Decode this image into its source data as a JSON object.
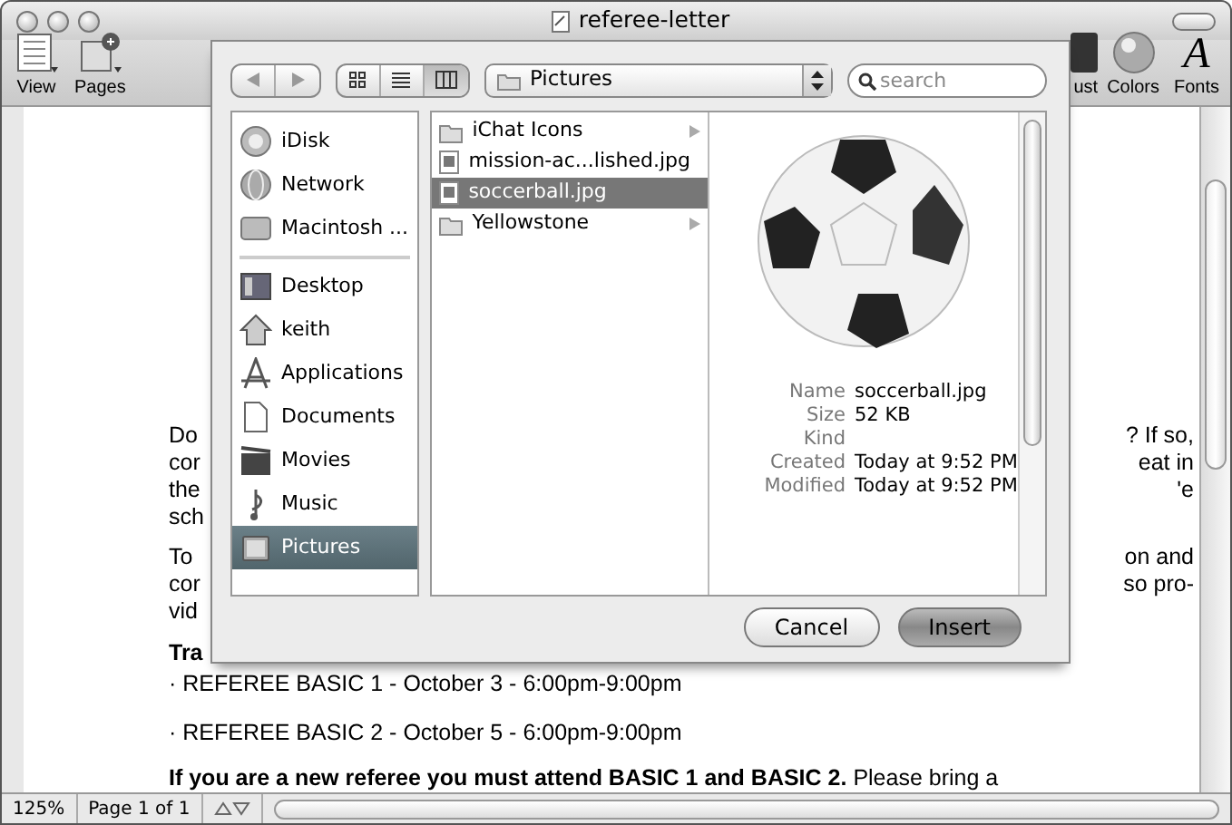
{
  "window": {
    "title": "referee-letter"
  },
  "toolbar": {
    "left": [
      {
        "label": "View",
        "kind": "view"
      },
      {
        "label": "Pages",
        "kind": "pages"
      }
    ],
    "right": [
      {
        "label": "ust",
        "kind": "adjust"
      },
      {
        "label": "Colors",
        "kind": "colors"
      },
      {
        "label": "Fonts",
        "kind": "fonts",
        "glyph": "A"
      }
    ]
  },
  "document": {
    "lines": [
      {
        "left": "Do",
        "right": "? If so,"
      },
      {
        "left": "cor",
        "right": "eat in"
      },
      {
        "left": "the",
        "right": "'e"
      },
      {
        "left": "sch"
      },
      {
        "left": "To",
        "right": "on and",
        "gap": true
      },
      {
        "left": "cor",
        "right": "so pro-"
      },
      {
        "left": "vid"
      }
    ],
    "schedule_heading": "Tra",
    "bullets": [
      "· REFEREE BASIC 1 - October 3 - 6:00pm-9:00pm",
      "· REFEREE BASIC 2 - October 5 - 6:00pm-9:00pm"
    ],
    "note": "**If you are a new referee you must attend BASIC 1 and BASIC 2.** Please bring a"
  },
  "dialog": {
    "view_modes": [
      {
        "kind": "icon",
        "selected": false
      },
      {
        "kind": "list",
        "selected": false
      },
      {
        "kind": "column",
        "selected": true
      }
    ],
    "location": "Pictures",
    "search_placeholder": "search",
    "sidebar": {
      "devices": [
        {
          "label": "iDisk",
          "kind": "idisk",
          "selected": false
        },
        {
          "label": "Network",
          "kind": "network",
          "selected": false
        },
        {
          "label": "Macintosh ...",
          "kind": "drive",
          "selected": false
        }
      ],
      "places": [
        {
          "label": "Desktop",
          "kind": "desktop",
          "selected": false
        },
        {
          "label": "keith",
          "kind": "home",
          "selected": false
        },
        {
          "label": "Applications",
          "kind": "apps",
          "selected": false
        },
        {
          "label": "Documents",
          "kind": "documents",
          "selected": false
        },
        {
          "label": "Movies",
          "kind": "movies",
          "selected": false
        },
        {
          "label": "Music",
          "kind": "music",
          "selected": false
        },
        {
          "label": "Pictures",
          "kind": "pictures",
          "selected": true
        }
      ]
    },
    "files": [
      {
        "name": "iChat Icons",
        "kind": "folder",
        "selected": false
      },
      {
        "name": "mission-ac...lished.jpg",
        "kind": "image",
        "selected": false
      },
      {
        "name": "soccerball.jpg",
        "kind": "image",
        "selected": true
      },
      {
        "name": "Yellowstone",
        "kind": "folder",
        "selected": false
      }
    ],
    "preview": {
      "info": [
        {
          "label": "Name",
          "value": "soccerball.jpg"
        },
        {
          "label": "Size",
          "value": "52 KB"
        },
        {
          "label": "Kind"
        },
        {
          "label": "Created",
          "value": "Today at 9:52 PM"
        },
        {
          "label": "Modified",
          "value": "Today at 9:52 PM"
        }
      ]
    },
    "buttons": [
      {
        "label": "Cancel",
        "default": false
      },
      {
        "label": "Insert",
        "default": true
      }
    ]
  },
  "status_bar": {
    "zoom": "125%",
    "page": "Page 1 of 1"
  }
}
